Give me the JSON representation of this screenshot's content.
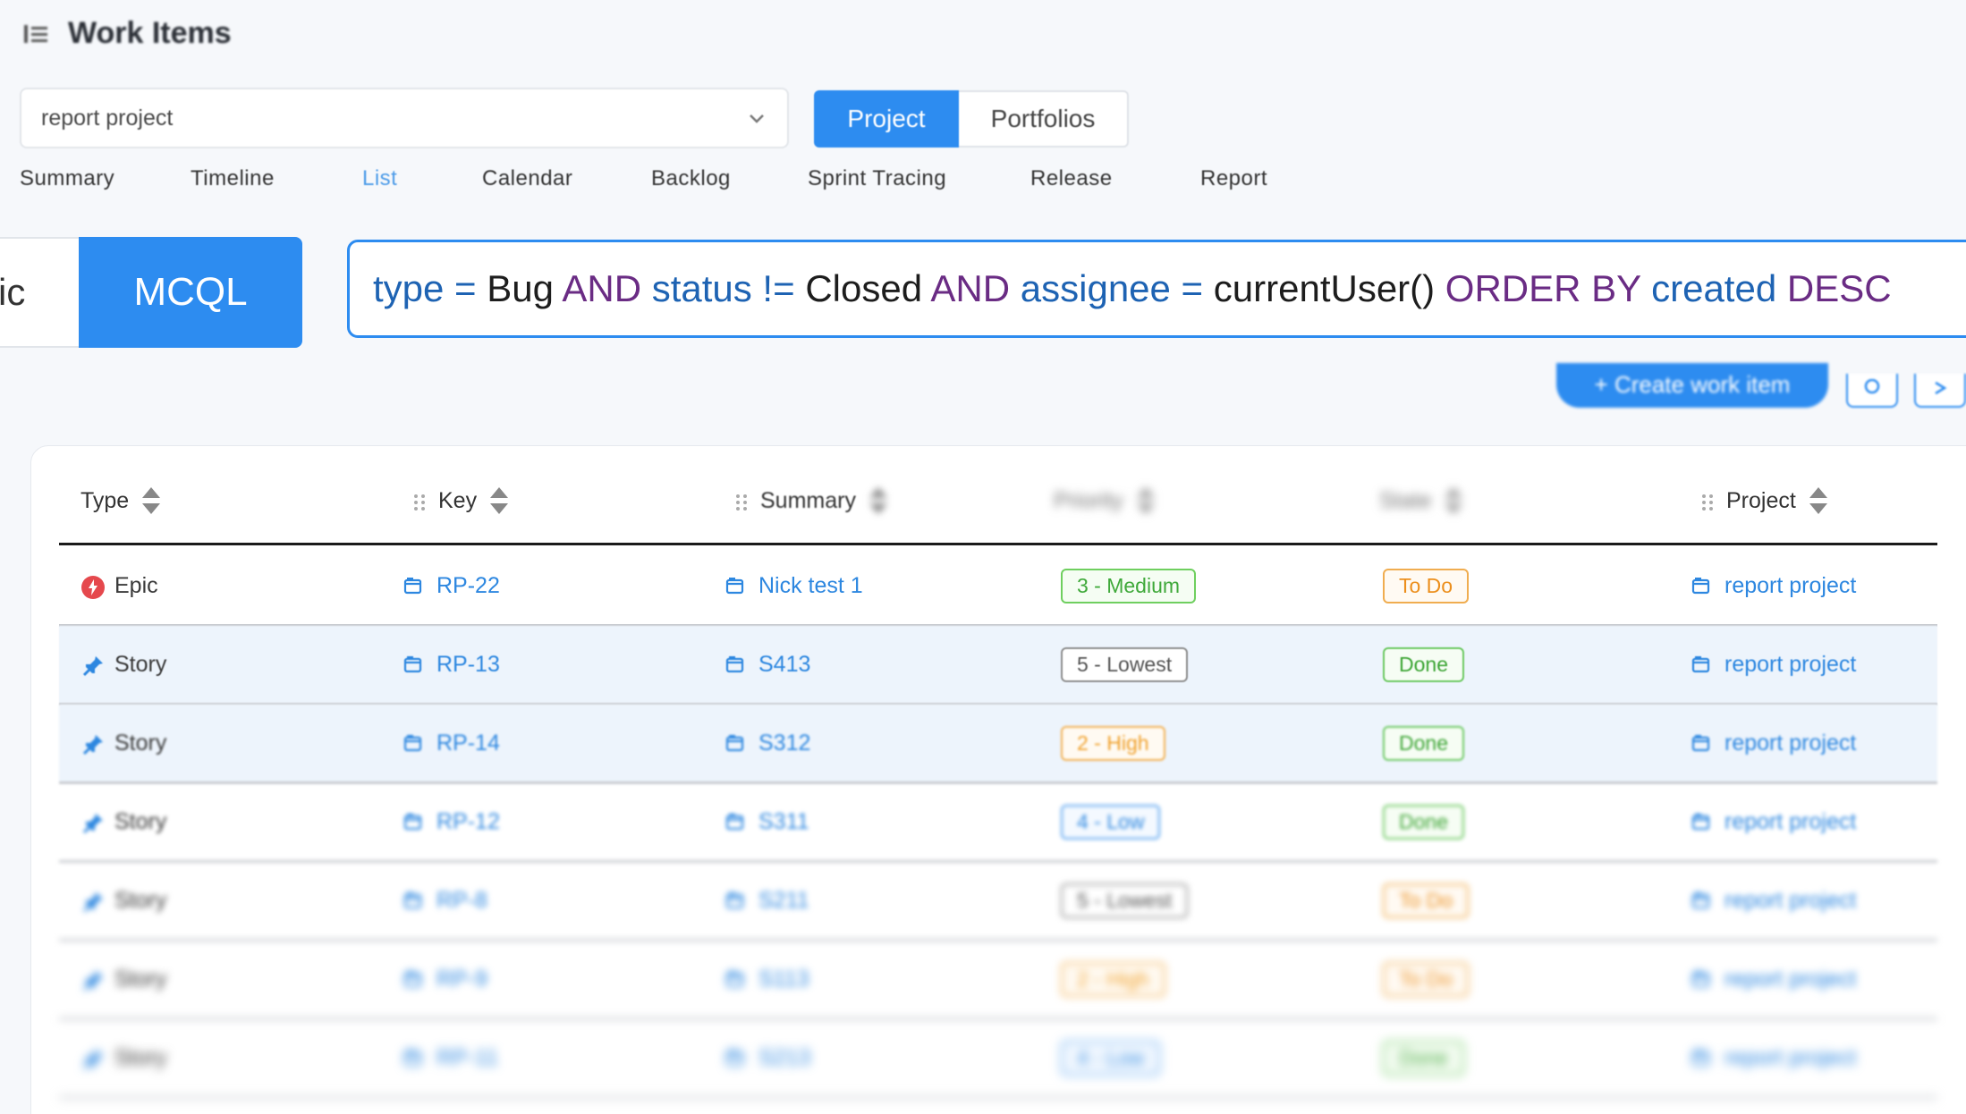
{
  "header": {
    "title": "Work Items"
  },
  "project_select": {
    "value": "report project"
  },
  "scope_toggle": {
    "project": "Project",
    "portfolios": "Portfolios"
  },
  "nav": {
    "tabs": [
      "Summary",
      "Timeline",
      "List",
      "Calendar",
      "Backlog",
      "Sprint Tracing",
      "Release",
      "Report"
    ],
    "active": "List"
  },
  "query": {
    "mode_basic_visible": "ic",
    "mode_mcql": "MCQL",
    "tokens": [
      {
        "t": "type",
        "k": "field"
      },
      {
        "t": " = ",
        "k": "field"
      },
      {
        "t": "Bug",
        "k": "val"
      },
      {
        "t": " AND ",
        "k": "kw"
      },
      {
        "t": "status",
        "k": "field"
      },
      {
        "t": " != ",
        "k": "field"
      },
      {
        "t": "Closed",
        "k": "val"
      },
      {
        "t": " AND ",
        "k": "kw"
      },
      {
        "t": "assignee",
        "k": "field"
      },
      {
        "t": " = ",
        "k": "field"
      },
      {
        "t": "currentUser()",
        "k": "val"
      },
      {
        "t": " ORDER BY ",
        "k": "kw"
      },
      {
        "t": "created",
        "k": "field"
      },
      {
        "t": " DESC",
        "k": "kw"
      }
    ]
  },
  "toolbar": {
    "create_label": "+ Create work item"
  },
  "table": {
    "headers": {
      "type": "Type",
      "key": "Key",
      "summary": "Summary",
      "priority": "Priority",
      "state": "State",
      "project": "Project"
    },
    "rows": [
      {
        "type": "Epic",
        "type_icon": "epic-icon",
        "key": "RP-22",
        "summary": "Nick test 1",
        "priority": "3 - Medium",
        "priority_level": "medium",
        "state": "To Do",
        "state_level": "todo",
        "project": "report project",
        "blur": 0,
        "selected": false
      },
      {
        "type": "Story",
        "type_icon": "story-pin-icon",
        "key": "RP-13",
        "summary": "S413",
        "priority": "5 - Lowest",
        "priority_level": "lowest",
        "state": "Done",
        "state_level": "done",
        "project": "report project",
        "blur": 0.6,
        "selected": true
      },
      {
        "type": "Story",
        "type_icon": "story-pin-icon",
        "key": "RP-14",
        "summary": "S312",
        "priority": "2 - High",
        "priority_level": "high",
        "state": "Done",
        "state_level": "done",
        "project": "report project",
        "blur": 1.3,
        "selected": true
      },
      {
        "type": "Story",
        "type_icon": "story-pin-icon",
        "key": "RP-12",
        "summary": "S311",
        "priority": "4 - Low",
        "priority_level": "low",
        "state": "Done",
        "state_level": "done",
        "project": "report project",
        "blur": 2.2,
        "selected": false
      },
      {
        "type": "Story",
        "type_icon": "story-pin-icon",
        "key": "RP-8",
        "summary": "S211",
        "priority": "5 - Lowest",
        "priority_level": "lowest",
        "state": "To Do",
        "state_level": "todo",
        "project": "report project",
        "blur": 3.4,
        "selected": false
      },
      {
        "type": "Story",
        "type_icon": "story-pin-icon",
        "key": "RP-9",
        "summary": "S113",
        "priority": "2 - High",
        "priority_level": "high",
        "state": "To Do",
        "state_level": "todo",
        "project": "report project",
        "blur": 4.6,
        "selected": false
      },
      {
        "type": "Story",
        "type_icon": "story-pin-icon",
        "key": "RP-11",
        "summary": "S213",
        "priority": "4 - Low",
        "priority_level": "low",
        "state": "Done",
        "state_level": "done",
        "project": "report project",
        "blur": 5.6,
        "selected": false
      }
    ]
  },
  "colors": {
    "accent": "#2d8cf0",
    "field": "#1e63b3",
    "keyword": "#6a2c84"
  }
}
